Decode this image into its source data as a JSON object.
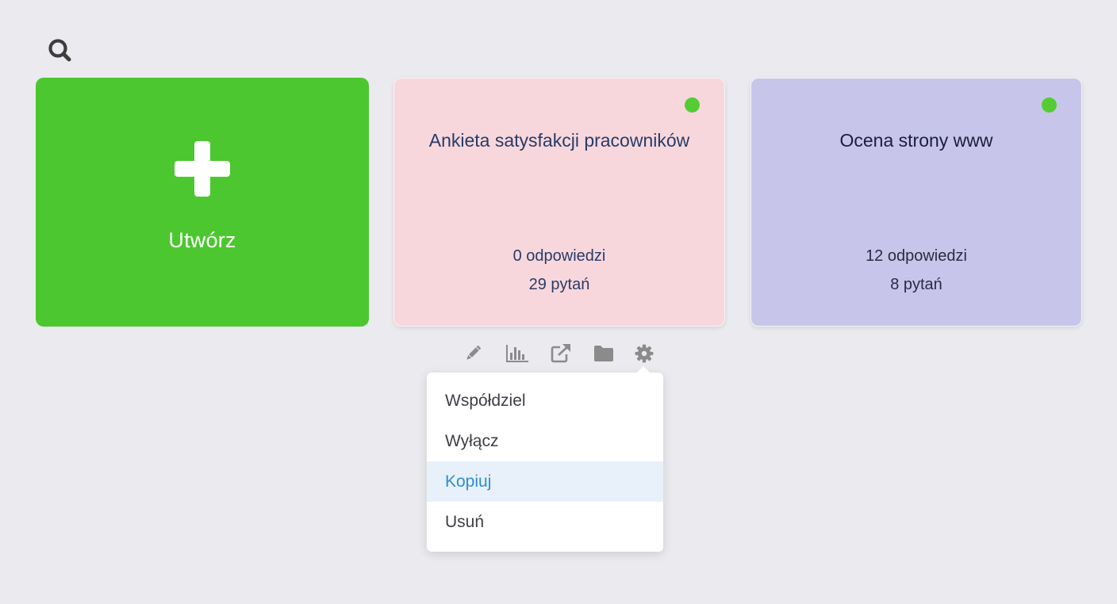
{
  "search": {
    "icon": "search-icon"
  },
  "create_card": {
    "label": "Utwórz",
    "icon": "plus-icon",
    "color": "#4cc72f"
  },
  "surveys": [
    {
      "title": "Ankieta satysfakcji pracowników",
      "responses": "0 odpowiedzi",
      "questions": "29 pytań",
      "status": "active",
      "status_color": "#55cc33",
      "background": "#f8d7dc"
    },
    {
      "title": "Ocena strony www",
      "responses": "12 odpowiedzi",
      "questions": "8 pytań",
      "status": "active",
      "status_color": "#55cc33",
      "background": "#c7c6ea"
    }
  ],
  "toolbar": {
    "icons": [
      "pencil-icon",
      "bar-chart-icon",
      "external-link-icon",
      "folder-icon",
      "gear-icon"
    ]
  },
  "settings_menu": {
    "items": [
      {
        "label": "Współdziel",
        "active": false
      },
      {
        "label": "Wyłącz",
        "active": false
      },
      {
        "label": "Kopiuj",
        "active": true
      },
      {
        "label": "Usuń",
        "active": false
      }
    ],
    "active_color": "#2c8ed3",
    "active_background": "#e8f1fa"
  }
}
